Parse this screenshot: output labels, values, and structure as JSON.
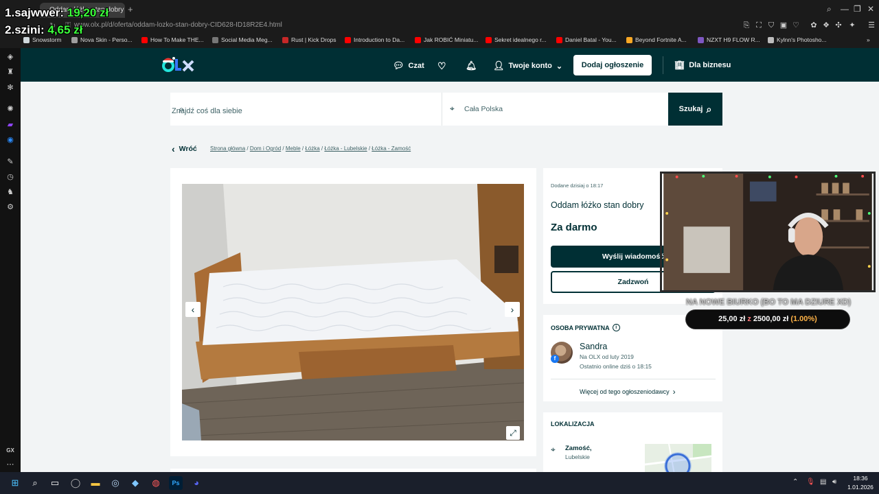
{
  "browser": {
    "tab_title": "Oddam łóżko stan dobry",
    "new_tab": "+",
    "url": "www.olx.pl/d/oferta/oddam-lozko-stan-dobry-CID628-ID18R2E4.html",
    "bookmarks": [
      {
        "label": "Snowstorm",
        "color": "#cfd8dc"
      },
      {
        "label": "Nova Skin - Perso...",
        "color": "#9e9e9e"
      },
      {
        "label": "How To Make THE...",
        "color": "#ff0000"
      },
      {
        "label": "Social Media Meg...",
        "color": "#777777"
      },
      {
        "label": "Rust | Kick Drops",
        "color": "#c62828"
      },
      {
        "label": "Introduction to Da...",
        "color": "#ff0000"
      },
      {
        "label": "Jak ROBIĆ Miniatu...",
        "color": "#ff0000"
      },
      {
        "label": "Sekret idealnego r...",
        "color": "#ff0000"
      },
      {
        "label": "Daniel Batal - You...",
        "color": "#ff0000"
      },
      {
        "label": "Beyond Fortnite A...",
        "color": "#f9a825"
      },
      {
        "label": "NZXT H9 FLOW R...",
        "color": "#7e57c2"
      },
      {
        "label": "Kylnn's Photosho...",
        "color": "#bdbdbd"
      }
    ],
    "gx_label": "GX"
  },
  "header": {
    "logo": "OLX",
    "chat": "Czat",
    "account": "Twoje konto",
    "add_ad": "Dodaj ogłoszenie",
    "business": "Dla biznesu"
  },
  "search": {
    "placeholder": "Znajdź coś dla siebie",
    "location": "Cała Polska",
    "button": "Szukaj"
  },
  "nav": {
    "back": "Wróć",
    "breadcrumb": [
      "Strona główna",
      "Dom i Ogród",
      "Meble",
      "Łóżka",
      "Łóżka - Lubelskie",
      "Łóżka - Zamość"
    ]
  },
  "offer": {
    "added": "Dodane dzisiaj o 18:17",
    "title": "Oddam łóżko stan dobry",
    "price": "Za darmo",
    "message_button": "Wyślij wiadomość",
    "call_button": "Zadzwoń"
  },
  "seller": {
    "type": "OSOBA PRYWATNA",
    "name": "Sandra",
    "since": "Na OLX od luty 2019",
    "online": "Ostatnio online dziś o 18:15",
    "more_ads": "Więcej od tego ogłoszeniodawcy"
  },
  "location": {
    "title": "LOKALIZACJA",
    "city": "Zamość,",
    "region": "Lubelskie"
  },
  "overlay": {
    "leaders": [
      {
        "rank": "1.",
        "name": "sajwwer:",
        "amount": "19,20 zł"
      },
      {
        "rank": "2.",
        "name": "szini:",
        "amount": "4,65 zł"
      }
    ],
    "goal_caption": "NA NOWE BIURKO (BO TO MA DZIURE XD)",
    "goal_current": "25,00 zł",
    "goal_sep": "z",
    "goal_target": "2500,00 zł",
    "goal_pct": "(1.00%)",
    "goal_fraction": 0.01
  },
  "taskbar": {
    "time": "18:36",
    "date": "1.01.2026",
    "ps_label": "Ps"
  }
}
